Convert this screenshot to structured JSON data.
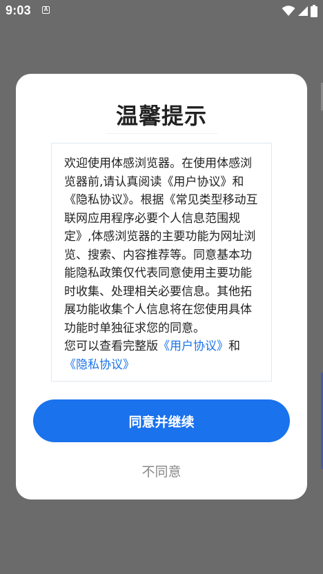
{
  "status_bar": {
    "time": "9:03",
    "notification_glyph": "A",
    "icons": [
      "wifi-icon",
      "signal-icon",
      "battery-icon"
    ]
  },
  "dialog": {
    "title": "温馨提示",
    "paragraph_1": "欢迎使用体感浏览器。在使用体感浏览器前,请认真阅读《用户协议》和《隐私协议》。根据《常见类型移动互联网应用程序必要个人信息范围规定》,体感浏览器的主要功能为网址浏览、搜索、内容推荐等。同意基本功能隐私政策仅代表同意使用主要功能时收集、处理相关必要信息。其他拓展功能收集个人信息将在您使用具体功能时单独征求您的同意。",
    "view_prefix": "您可以查看完整版",
    "user_agreement_link": "《用户协议》",
    "and_text": "和",
    "privacy_agreement_link": "《隐私协议》",
    "agree_button": "同意并继续",
    "disagree_button": "不同意"
  },
  "colors": {
    "overlay": "#6b6b6b",
    "primary": "#1a72ed",
    "link": "#1a73e8",
    "secondary_text": "#888888"
  }
}
